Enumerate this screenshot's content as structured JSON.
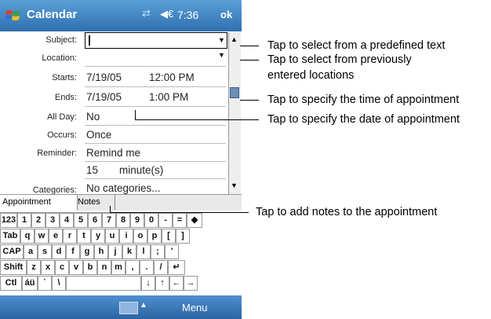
{
  "titlebar": {
    "title": "Calendar",
    "time": "7:36",
    "ok_label": "ok",
    "conn_glyph": "⇄",
    "volume_glyph": "◀€"
  },
  "form": {
    "subject_label": "Subject:",
    "location_label": "Location:",
    "starts_label": "Starts:",
    "starts_date": "7/19/05",
    "starts_time": "12:00 PM",
    "ends_label": "Ends:",
    "ends_date": "7/19/05",
    "ends_time": "1:00 PM",
    "allday_label": "All Day:",
    "allday_value": "No",
    "occurs_label": "Occurs:",
    "occurs_value": "Once",
    "reminder_label": "Reminder:",
    "reminder_value": "Remind me",
    "reminder_amount": "15",
    "reminder_unit": "minute(s)",
    "categories_label": "Categories:",
    "categories_value": "No categories..."
  },
  "tabs": [
    "Appointment",
    "Notes"
  ],
  "keyboard": {
    "rows": [
      [
        "123",
        "1",
        "2",
        "3",
        "4",
        "5",
        "6",
        "7",
        "8",
        "9",
        "0",
        "-",
        "=",
        "◆"
      ],
      [
        "Tab",
        "q",
        "w",
        "e",
        "r",
        "t",
        "y",
        "u",
        "i",
        "o",
        "p",
        "[",
        "]"
      ],
      [
        "CAP",
        "a",
        "s",
        "d",
        "f",
        "g",
        "h",
        "j",
        "k",
        "l",
        ";",
        "'"
      ],
      [
        "Shift",
        "z",
        "x",
        "c",
        "v",
        "b",
        "n",
        "m",
        ",",
        ".",
        "/",
        "↵"
      ],
      [
        "Ctl",
        "áü",
        "`",
        "\\",
        "",
        "↓",
        "↑",
        "←",
        "→"
      ]
    ]
  },
  "menubar": {
    "menu_label": "Menu",
    "up_glyph": "▲"
  },
  "callouts": {
    "subject": "Tap to select from a predefined text",
    "location_1": "Tap to select from previously",
    "location_2": "entered locations",
    "time": "Tap to specify the time of appointment",
    "date": "Tap to specify the date of appointment",
    "notes": "Tap to add notes to the appointment"
  }
}
